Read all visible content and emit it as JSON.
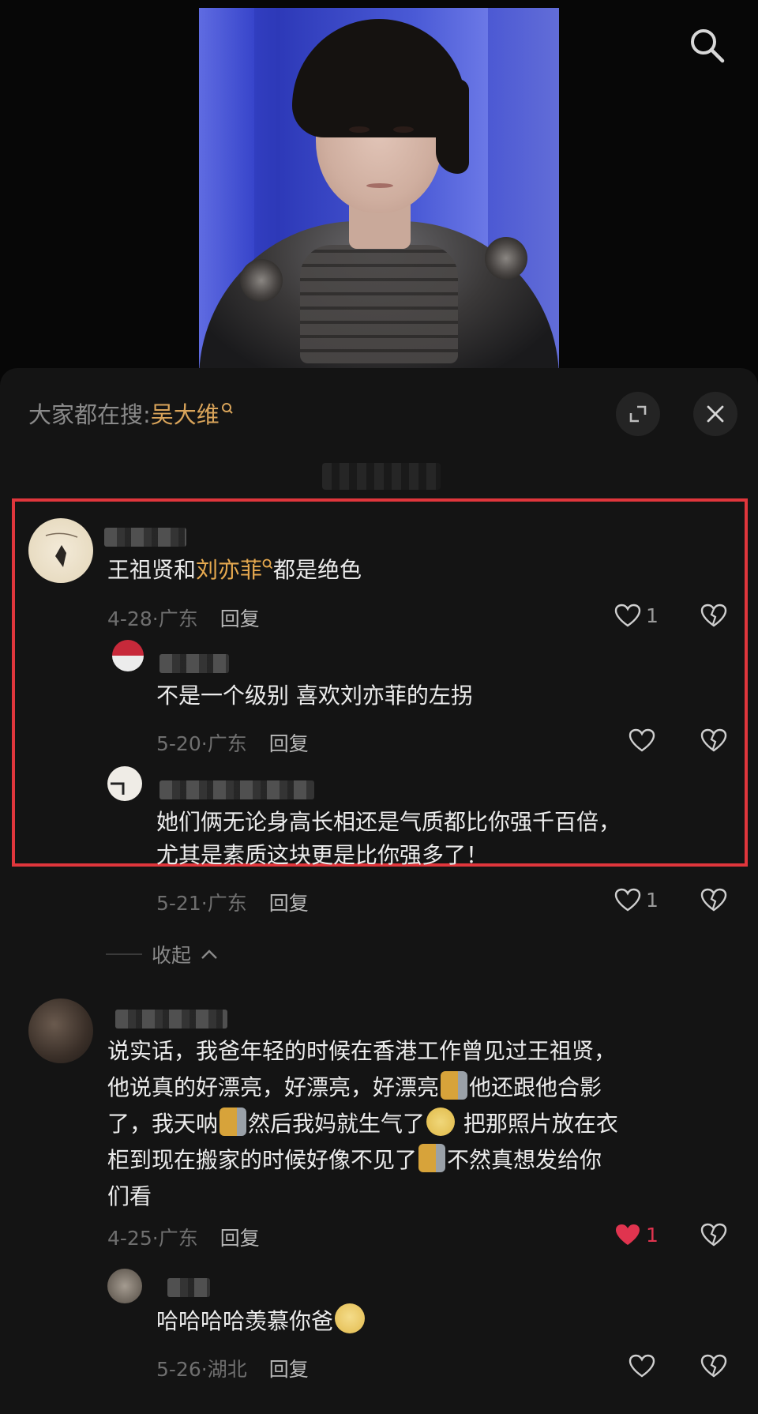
{
  "search": {
    "icon": "search-icon"
  },
  "sheet": {
    "search_prefix": "大家都在搜:",
    "search_keyword": "吴大维",
    "highlight_color": "#e0363c",
    "keyword_color": "#d9a45a"
  },
  "comments": [
    {
      "text_before": "王祖贤和",
      "keyword": "刘亦菲",
      "text_after": "都是绝色",
      "date": "4-28",
      "region": "广东",
      "reply": "回复",
      "likes": "1",
      "replies": [
        {
          "text": "不是一个级别 喜欢刘亦菲的左拐",
          "date": "5-20",
          "region": "广东",
          "reply": "回复",
          "likes": ""
        },
        {
          "text_line1": "她们俩无论身高长相还是气质都比你强千百倍，",
          "text_line2": "尤其是素质这块更是比你强多了！",
          "date": "5-21",
          "region": "广东",
          "reply": "回复",
          "likes": "1"
        }
      ]
    },
    {
      "line1": "说实话，我爸年轻的时候在香港工作曾见过王祖贤，",
      "line2a": "他说真的好漂亮，好漂亮，好漂亮",
      "line2b": "他还跟他合影",
      "line3a": "了，我天呐",
      "line3b": "然后我妈就生气了",
      "line3c": " 把那照片放在衣",
      "line4a": "柜到现在搬家的时候好像不见了",
      "line4b": "不然真想发给你",
      "line5": "们看",
      "date": "4-25",
      "region": "广东",
      "reply": "回复",
      "likes": "1",
      "liked_color": "#e0344f",
      "replies": [
        {
          "text": "哈哈哈哈羡慕你爸",
          "date": "5-26",
          "region": "湖北",
          "reply": "回复",
          "likes": ""
        }
      ]
    }
  ],
  "collapse_label": "收起"
}
